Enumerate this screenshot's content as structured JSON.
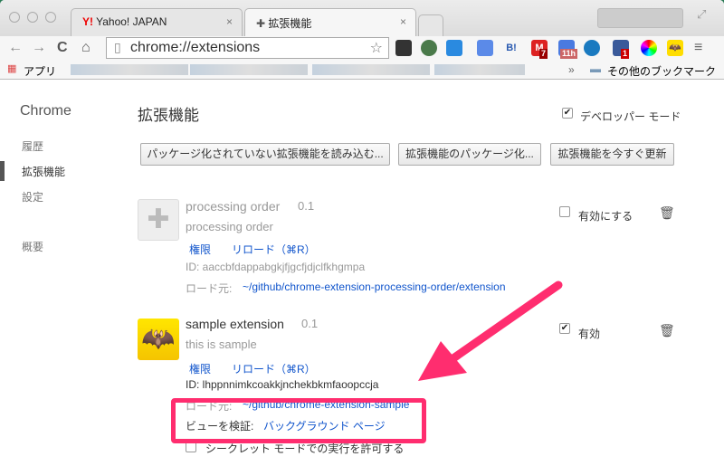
{
  "tabs": [
    {
      "label": "Yahoo! JAPAN",
      "favicon": "Y!"
    },
    {
      "label": "拡張機能",
      "favicon": "puzzle-icon"
    }
  ],
  "address": "chrome://extensions",
  "extension_badges": {
    "gmail": "7",
    "calendar": "11h",
    "other": "1"
  },
  "bookmarks": {
    "apps": "アプリ",
    "other": "その他のブックマーク",
    "overflow": "»"
  },
  "sidebar": {
    "title": "Chrome",
    "items": [
      {
        "label": "履歴"
      },
      {
        "label": "拡張機能",
        "selected": true
      },
      {
        "label": "設定"
      },
      {
        "label": "概要"
      }
    ]
  },
  "main": {
    "title": "拡張機能",
    "dev_mode_label": "デベロッパー モード",
    "dev_mode_checked": true,
    "buttons": {
      "load": "パッケージ化されていない拡張機能を読み込む...",
      "pack": "拡張機能のパッケージ化...",
      "update": "拡張機能を今すぐ更新"
    },
    "extensions": [
      {
        "name": "processing order",
        "version": "0.1",
        "description": "processing order",
        "permissions": "権限",
        "reload": "リロード（⌘R）",
        "id": "ID: aaccbfdappabgkjfjgcfjdjclfkhgmpa",
        "load_label": "ロード元:",
        "load_path": "~/github/chrome-extension-processing-order/extension",
        "enable_label": "有効にする",
        "enabled": false
      },
      {
        "name": "sample extension",
        "version": "0.1",
        "description": "this is sample",
        "permissions": "権限",
        "reload": "リロード（⌘R）",
        "id": "ID: lhppnnimkcoakkjnchekbkmfaoopccja",
        "load_label": "ロード元:",
        "load_path": "~/github/chrome-extension-sample",
        "inspect_label": "ビューを検証:",
        "inspect_link": "バックグラウンド ページ",
        "incognito_label": "シークレット モードでの実行を許可する",
        "enable_label": "有効",
        "enabled": true
      }
    ]
  },
  "annotation_color": "#ff2d6f"
}
